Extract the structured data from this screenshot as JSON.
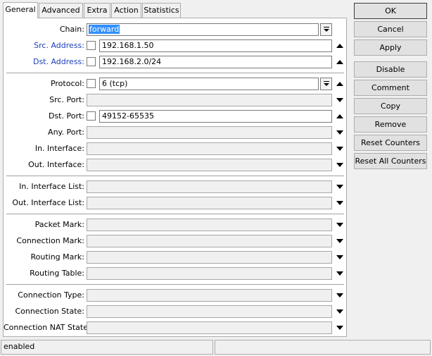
{
  "tabs": [
    {
      "label": "General",
      "active": true
    },
    {
      "label": "Advanced"
    },
    {
      "label": "Extra"
    },
    {
      "label": "Action"
    },
    {
      "label": "Statistics"
    }
  ],
  "fields": {
    "chain": {
      "label": "Chain:",
      "value": "forward"
    },
    "src_address": {
      "label": "Src. Address:",
      "value": "192.168.1.50"
    },
    "dst_address": {
      "label": "Dst. Address:",
      "value": "192.168.2.0/24"
    },
    "protocol": {
      "label": "Protocol:",
      "value": "6 (tcp)"
    },
    "src_port": {
      "label": "Src. Port:",
      "value": ""
    },
    "dst_port": {
      "label": "Dst. Port:",
      "value": "49152-65535"
    },
    "any_port": {
      "label": "Any. Port:",
      "value": ""
    },
    "in_interface": {
      "label": "In. Interface:",
      "value": ""
    },
    "out_interface": {
      "label": "Out. Interface:",
      "value": ""
    },
    "in_interface_list": {
      "label": "In. Interface List:",
      "value": ""
    },
    "out_interface_list": {
      "label": "Out. Interface List:",
      "value": ""
    },
    "packet_mark": {
      "label": "Packet Mark:",
      "value": ""
    },
    "connection_mark": {
      "label": "Connection Mark:",
      "value": ""
    },
    "routing_mark": {
      "label": "Routing Mark:",
      "value": ""
    },
    "routing_table": {
      "label": "Routing Table:",
      "value": ""
    },
    "connection_type": {
      "label": "Connection Type:",
      "value": ""
    },
    "connection_state": {
      "label": "Connection State:",
      "value": ""
    },
    "connection_nat_state": {
      "label": "Connection NAT State:",
      "value": ""
    }
  },
  "buttons": {
    "ok": "OK",
    "cancel": "Cancel",
    "apply": "Apply",
    "disable": "Disable",
    "comment": "Comment",
    "copy": "Copy",
    "remove": "Remove",
    "reset_counters": "Reset Counters",
    "reset_all_counters": "Reset All Counters"
  },
  "status": {
    "left": "enabled",
    "right": ""
  },
  "colors": {
    "address_label": "#1c3fb8",
    "selection": "#3390ff"
  }
}
